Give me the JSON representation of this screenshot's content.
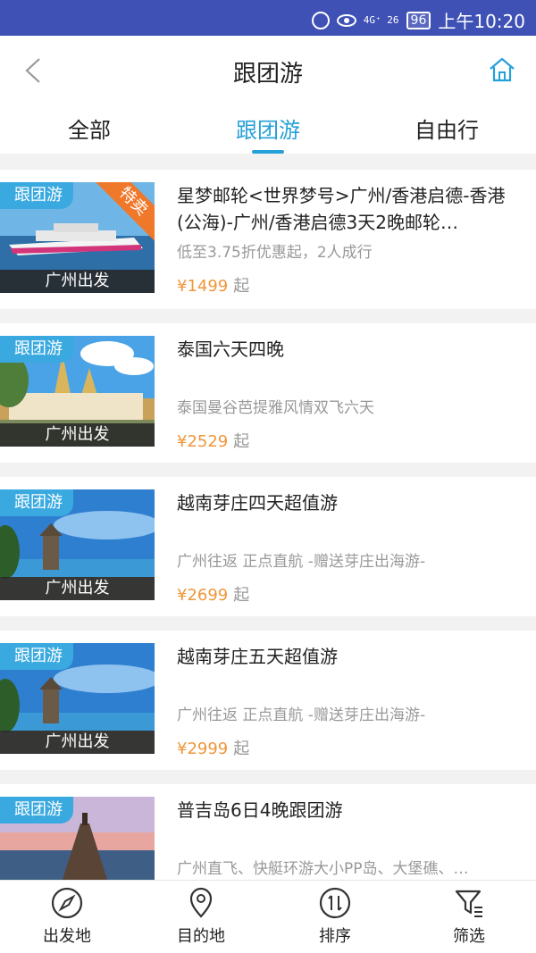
{
  "status_bar": {
    "signal_text": "4G⁺ 26",
    "battery": "96",
    "time": "上午10:20",
    "icons": [
      "alarm-icon",
      "eye-icon",
      "signal-icon",
      "battery-icon"
    ]
  },
  "header": {
    "title": "跟团游",
    "back_icon": "chevron-left-icon",
    "home_icon": "home-icon"
  },
  "tabs": [
    {
      "label": "全部",
      "active": false
    },
    {
      "label": "跟团游",
      "active": true
    },
    {
      "label": "自由行",
      "active": false
    }
  ],
  "products": [
    {
      "tag": "跟团游",
      "badge": "特卖",
      "origin": "广州出发",
      "title": "星梦邮轮<世界梦号>广州/香港启德-香港(公海)-广州/香港启德3天2晚邮轮…",
      "desc": "低至3.75折优惠起，2人成行",
      "price": "¥1499",
      "price_suffix": "起"
    },
    {
      "tag": "跟团游",
      "origin": "广州出发",
      "title": "泰国六天四晚",
      "desc": "泰国曼谷芭提雅风情双飞六天",
      "price": "¥2529",
      "price_suffix": "起"
    },
    {
      "tag": "跟团游",
      "origin": "广州出发",
      "title": "越南芽庄四天超值游",
      "desc": "广州往返 正点直航 -赠送芽庄出海游-",
      "price": "¥2699",
      "price_suffix": "起"
    },
    {
      "tag": "跟团游",
      "origin": "广州出发",
      "title": "越南芽庄五天超值游",
      "desc": "广州往返 正点直航 -赠送芽庄出海游-",
      "price": "¥2999",
      "price_suffix": "起"
    },
    {
      "tag": "跟团游",
      "title": "普吉岛6日4晚跟团游",
      "desc": "广州直飞、快艇环游大小PP岛、大堡礁、…"
    }
  ],
  "bottom_nav": [
    {
      "label": "出发地",
      "icon": "compass-icon"
    },
    {
      "label": "目的地",
      "icon": "location-pin-icon"
    },
    {
      "label": "排序",
      "icon": "sort-icon"
    },
    {
      "label": "筛选",
      "icon": "filter-icon"
    }
  ],
  "colors": {
    "status_bar": "#3f51b5",
    "accent": "#26a0d8",
    "price": "#f0963a",
    "tag": "#3aa9e0",
    "badge": "#f0782b"
  }
}
